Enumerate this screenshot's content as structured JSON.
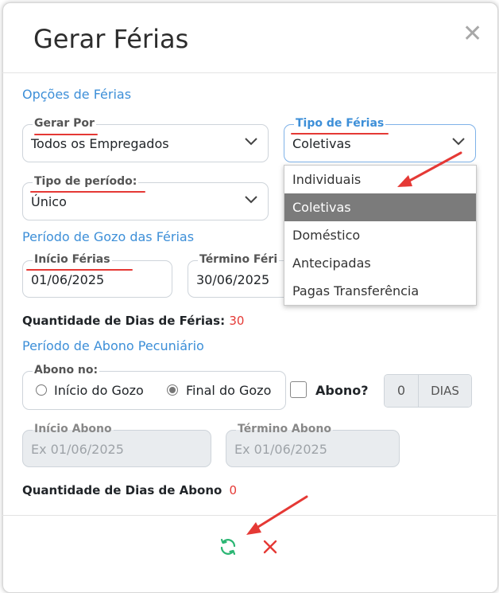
{
  "dialog": {
    "title": "Gerar Férias",
    "close_glyph": "✕"
  },
  "sections": {
    "opcoes": "Opções de Férias",
    "gozo": "Período de Gozo das Férias",
    "abono": "Período de Abono Pecuniário"
  },
  "fields": {
    "gerar_por": {
      "label": "Gerar Por",
      "value": "Todos os Empregados"
    },
    "tipo_ferias": {
      "label": "Tipo de Férias",
      "value": "Coletivas"
    },
    "tipo_periodo": {
      "label": "Tipo de período:",
      "value": "Único"
    },
    "inicio_ferias": {
      "label": "Início Férias",
      "value": "01/06/2025"
    },
    "termino_ferias": {
      "label": "Término Féri",
      "value": "30/06/2025"
    },
    "abono_no": {
      "label": "Abono no:",
      "options": [
        "Início do Gozo",
        "Final do Gozo"
      ],
      "selected": "Final do Gozo"
    },
    "inicio_abono": {
      "label": "Início Abono",
      "placeholder": "Ex 01/06/2025"
    },
    "termino_abono": {
      "label": "Término Abono",
      "placeholder": "Ex 01/06/2025"
    }
  },
  "dropdown": {
    "options": [
      "Individuais",
      "Coletivas",
      "Doméstico",
      "Antecipadas",
      "Pagas Transferência"
    ],
    "selected": "Coletivas"
  },
  "quantidades": {
    "ferias_label": "Quantidade de Dias de Férias:",
    "ferias_value": "30",
    "abono_label": "Quantidade de Dias de Abono",
    "abono_value": "0"
  },
  "abono_checkbox": {
    "label": "Abono?",
    "checked": false,
    "days_value": "0",
    "days_unit": "DIAS"
  },
  "footer": {
    "refresh_icon": "refresh-icon",
    "cancel_icon": "close-icon"
  },
  "colors": {
    "accent_blue": "#3d8fd8",
    "annotation_red": "#e53935",
    "refresh_green": "#2bb673",
    "cancel_red": "#e53935",
    "selected_option": "#7b7b7b"
  }
}
